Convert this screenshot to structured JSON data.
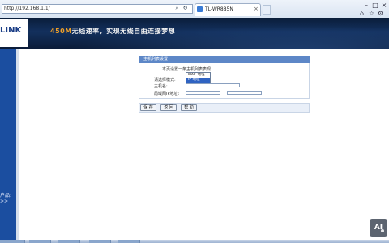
{
  "browser": {
    "url": "http://192.168.1.1/",
    "tab_title": "TL-WR885N",
    "nav_icons": [
      "search-refresh-icon",
      "close-tab-icon"
    ]
  },
  "banner": {
    "logo_text": "LINK",
    "slogan_highlight": "450M",
    "slogan_rest": "无线速率，实现无线自由连接梦想"
  },
  "sidebar": {
    "item_text": "户品:",
    "arrow_text": ">>"
  },
  "panel": {
    "header": "主机列表设置",
    "intro": "本页设置一条主机列表表现",
    "mode_label": "请选择模式:",
    "host_label": "主机名:",
    "ip_label": "局域网IP地址:",
    "ip_separator": "-",
    "dropdown_options": [
      "MAC 地址",
      "IP 地址"
    ],
    "selected_option": "IP 地址"
  },
  "buttons": {
    "save": "保 存",
    "back": "返 回",
    "help": "帮 助"
  },
  "watermark": {
    "text": "AI"
  },
  "colors": {
    "banner": "#13305d",
    "accent": "#f0a028",
    "panel_header": "#5d87c7",
    "sidebar": "#1b4ea0",
    "selection": "#2f63c2"
  }
}
